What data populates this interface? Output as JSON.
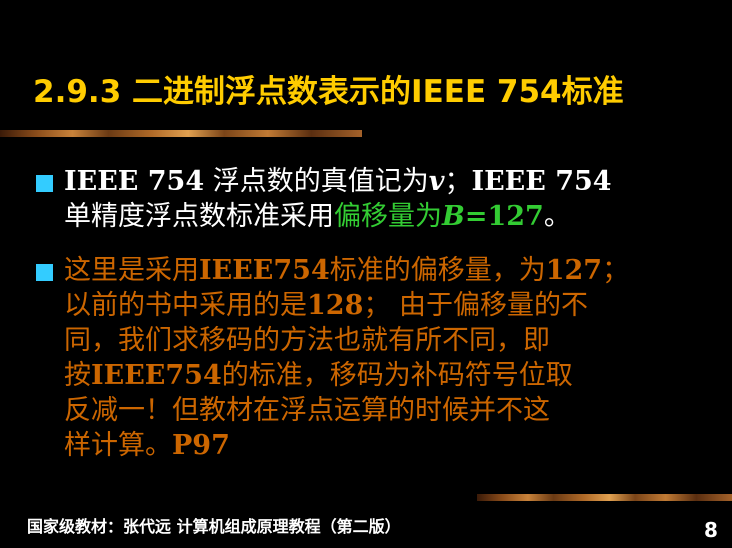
{
  "colors": {
    "background": "#000000",
    "title": "#FFCC00",
    "text_white": "#FFFFFF",
    "text_green": "#33CC33",
    "text_orange": "#CC6600",
    "bullet": "#33CCFF",
    "footer": "#FFFFFF"
  },
  "title": "2.9.3 二进制浮点数表示的IEEE 754标准",
  "paragraph1": {
    "bullet_icon": "square-bullet",
    "line1": {
      "part1": "IEEE 754",
      "part2": " 浮点数的真值记为",
      "part3": "v",
      "part4": "；",
      "part5": "IEEE 754"
    },
    "line2": {
      "part1": "单精度浮点数标准采用",
      "part2": "偏移量为",
      "part3": "B",
      "part4": "=127",
      "part5": "。"
    }
  },
  "paragraph2": {
    "bullet_icon": "square-bullet",
    "line1": {
      "part1": "这里是采用",
      "part2": "IEEE754",
      "part3": "标准的偏移量，为",
      "part4": "127",
      "part5": "；"
    },
    "line2": {
      "part1": "以前的书中采用的是",
      "part2": "128",
      "part3": "；  由于偏移量的不"
    },
    "line3": "同，我们求移码的方法也就有所不同，即",
    "line4": {
      "part1": "按",
      "part2": "IEEE754",
      "part3": "的标准，移码为补码符号位取"
    },
    "line5": "反减一！但教材在浮点运算的时候并不这",
    "line6": {
      "part1": "样计算。",
      "part2": "P97"
    }
  },
  "footer": "国家级教材：张代远  计算机组成原理教程（第二版）",
  "page_number": "8"
}
